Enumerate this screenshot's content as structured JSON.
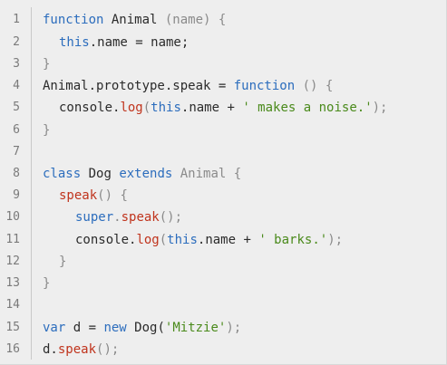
{
  "code": {
    "line_numbers": [
      "1",
      "2",
      "3",
      "4",
      "5",
      "6",
      "7",
      "8",
      "9",
      "10",
      "11",
      "12",
      "13",
      "14",
      "15",
      "16"
    ],
    "l1": {
      "kw_function": "function",
      "name": " Animal ",
      "params": "(name) {"
    },
    "l2": {
      "kw_this": "this",
      "rest": ".name = name;"
    },
    "l3": {
      "close": "}"
    },
    "l4": {
      "lhs": "Animal.prototype.speak = ",
      "kw_function": "function",
      "rest": " () {"
    },
    "l5": {
      "console": "console.",
      "log": "log",
      "open": "(",
      "kw_this": "this",
      "mid": ".name + ",
      "str": "' makes a noise.'",
      "close": ");"
    },
    "l6": {
      "close": "}"
    },
    "l8": {
      "kw_class": "class",
      "dog": " Dog ",
      "kw_extends": "extends",
      "rest": " Animal {"
    },
    "l9": {
      "speak": "speak",
      "rest": "() {"
    },
    "l10": {
      "kw_super": "super",
      "dot": ".",
      "speak": "speak",
      "rest": "();"
    },
    "l11": {
      "console": "console.",
      "log": "log",
      "open": "(",
      "kw_this": "this",
      "mid": ".name + ",
      "str": "' barks.'",
      "close": ");"
    },
    "l12": {
      "close": "}"
    },
    "l13": {
      "close": "}"
    },
    "l15": {
      "kw_var": "var",
      "d": " d = ",
      "kw_new": "new",
      "dog": " Dog(",
      "str": "'Mitzie'",
      "close": ");"
    },
    "l16": {
      "d": "d.",
      "speak": "speak",
      "rest": "();"
    }
  }
}
